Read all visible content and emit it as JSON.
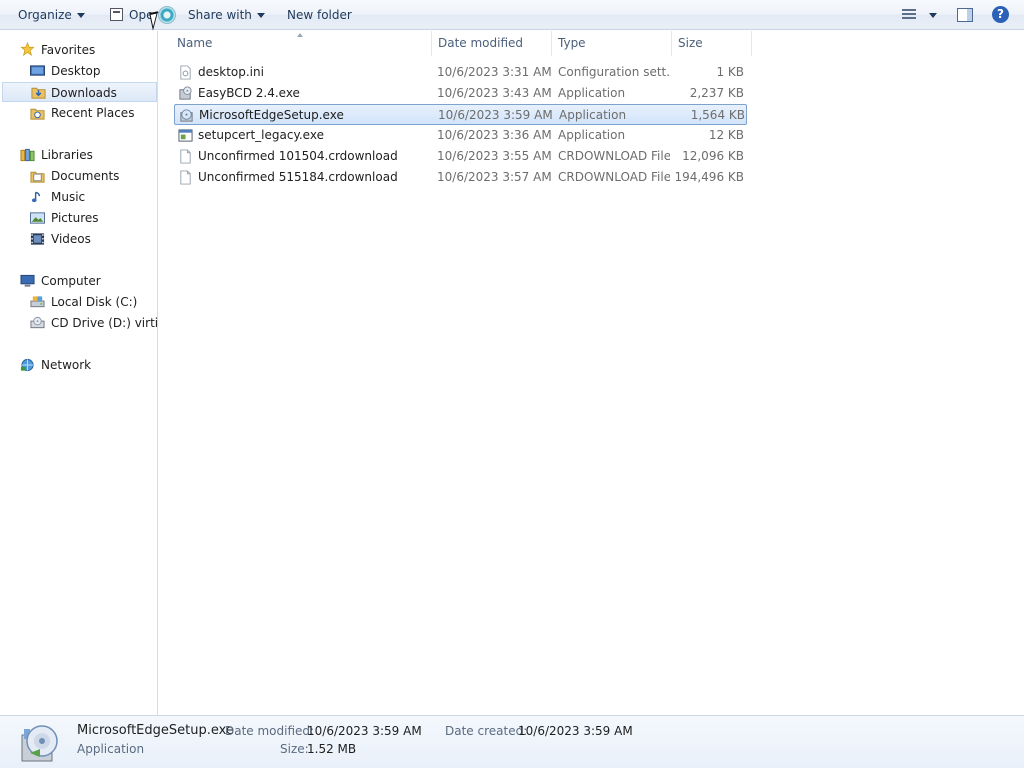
{
  "toolbar": {
    "organize": "Organize",
    "open": "Open",
    "share_with": "Share with",
    "new_folder": "New folder"
  },
  "nav": {
    "favorites": "Favorites",
    "desktop": "Desktop",
    "downloads": "Downloads",
    "recent_places": "Recent Places",
    "libraries": "Libraries",
    "documents": "Documents",
    "music": "Music",
    "pictures": "Pictures",
    "videos": "Videos",
    "computer": "Computer",
    "local_disk": "Local Disk (C:)",
    "cd_drive": "CD Drive (D:) virtio-w",
    "network": "Network"
  },
  "columns": {
    "name": "Name",
    "date_modified": "Date modified",
    "type": "Type",
    "size": "Size"
  },
  "files": [
    {
      "name": "desktop.ini",
      "date": "10/6/2023 3:31 AM",
      "type": "Configuration sett...",
      "size": "1 KB",
      "icon": "settings-file-icon"
    },
    {
      "name": "EasyBCD 2.4.exe",
      "date": "10/6/2023 3:43 AM",
      "type": "Application",
      "size": "2,237 KB",
      "icon": "installer-icon"
    },
    {
      "name": "MicrosoftEdgeSetup.exe",
      "date": "10/6/2023 3:59 AM",
      "type": "Application",
      "size": "1,564 KB",
      "icon": "installer-disc-icon"
    },
    {
      "name": "setupcert_legacy.exe",
      "date": "10/6/2023 3:36 AM",
      "type": "Application",
      "size": "12 KB",
      "icon": "application-window-icon"
    },
    {
      "name": "Unconfirmed 101504.crdownload",
      "date": "10/6/2023 3:55 AM",
      "type": "CRDOWNLOAD File",
      "size": "12,096 KB",
      "icon": "blank-file-icon"
    },
    {
      "name": "Unconfirmed 515184.crdownload",
      "date": "10/6/2023 3:57 AM",
      "type": "CRDOWNLOAD File",
      "size": "194,496 KB",
      "icon": "blank-file-icon"
    }
  ],
  "details": {
    "filename": "MicrosoftEdgeSetup.exe",
    "filetype": "Application",
    "date_modified_label": "Date modified:",
    "date_modified_value": "10/6/2023 3:59 AM",
    "size_label": "Size:",
    "size_value": "1.52 MB",
    "date_created_label": "Date created:",
    "date_created_value": "10/6/2023 3:59 AM"
  },
  "colors": {
    "selection_fill": "#d9e8fb",
    "selection_border": "#7da2ce",
    "toolbar_text": "#1e395b",
    "secondary_text": "#6d6d6d"
  }
}
